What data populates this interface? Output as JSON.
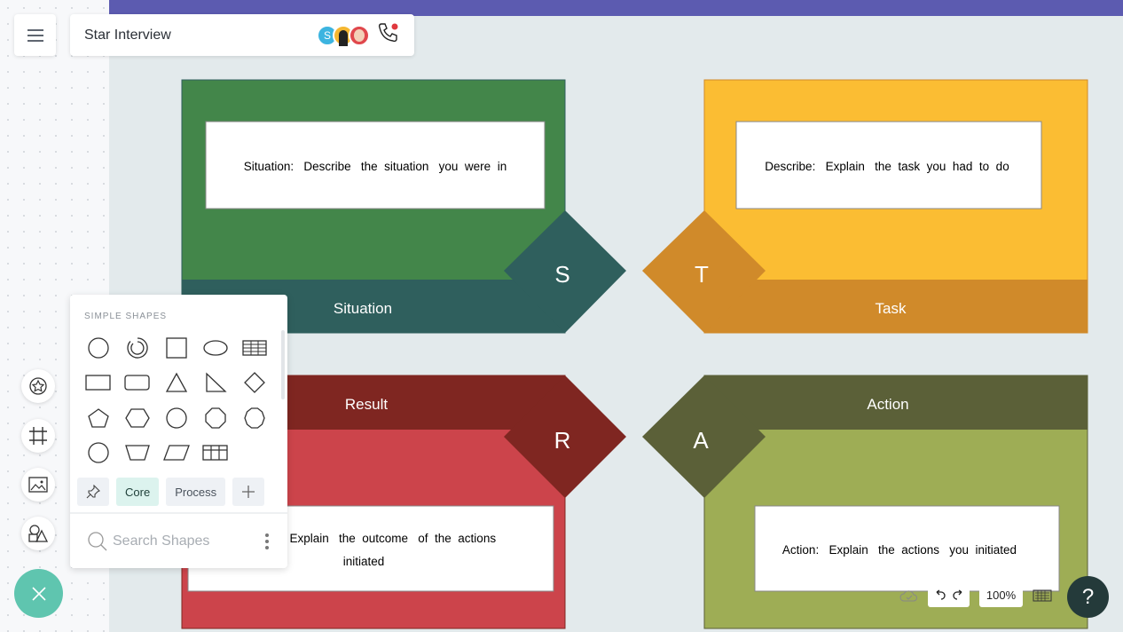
{
  "header": {
    "title": "Star Interview",
    "avatar_initial": "S",
    "avatar_colors": [
      "#3cb4e0",
      "#f5b731",
      "#e0474c"
    ],
    "call_icon": "phone-icon"
  },
  "diagram": {
    "situation": {
      "letter": "S",
      "label": "Situation",
      "text": "Situation:   Describe   the  situation   you  were  in",
      "color": "#43864a",
      "band": "#2f5f5d"
    },
    "task": {
      "letter": "T",
      "label": "Task",
      "text": "Describe:   Explain   the  task  you  had  to  do",
      "color": "#fbbd33",
      "band": "#d08a2a"
    },
    "result": {
      "letter": "R",
      "label": "Result",
      "text_line1": "Result:  Explain   the  outcome   of  the  actions",
      "text_line2": "initiated",
      "color": "#cc444b",
      "band": "#7f2621"
    },
    "action": {
      "letter": "A",
      "label": "Action",
      "text": "Action:   Explain   the  actions   you  initiated",
      "color": "#9ead55",
      "band": "#5b6038"
    }
  },
  "shapes_panel": {
    "header": "SIMPLE SHAPES",
    "tabs": [
      "Core",
      "Process"
    ],
    "active_tab": "Core",
    "search_placeholder": "Search Shapes"
  },
  "controls": {
    "zoom": "100%",
    "help": "?"
  },
  "colors": {
    "accent": "#5fc5af",
    "topbar": "#5c5bb0"
  }
}
